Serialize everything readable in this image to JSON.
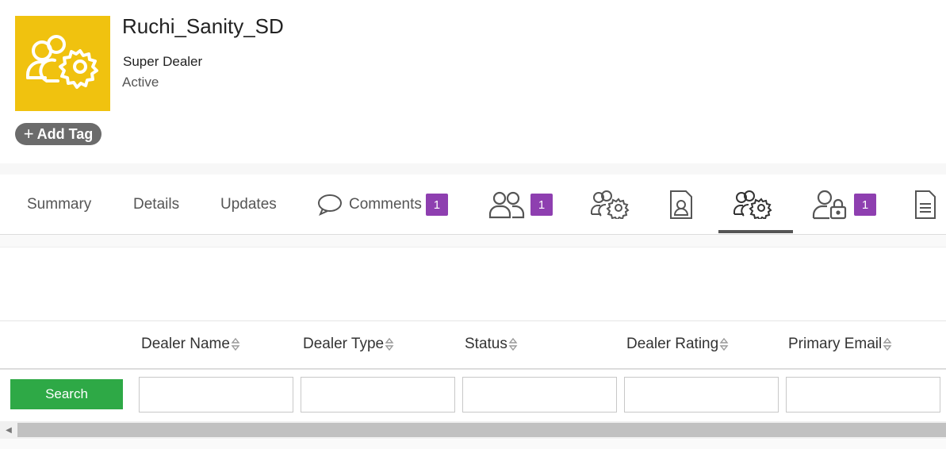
{
  "entity": {
    "title": "Ruchi_Sanity_SD",
    "type": "Super Dealer",
    "status": "Active",
    "avatar_icon": "users-gear-icon",
    "avatar_color": "#f0c20f"
  },
  "add_tag": {
    "label": "Add Tag",
    "plus": "+"
  },
  "tabs": [
    {
      "label": "Summary"
    },
    {
      "label": "Details"
    },
    {
      "label": "Updates"
    },
    {
      "label": "Comments",
      "icon": "comment-icon",
      "badge": "1"
    },
    {
      "icon": "users-icon",
      "badge": "1"
    },
    {
      "icon": "users-gear-icon"
    },
    {
      "icon": "id-badge-icon"
    },
    {
      "icon": "users-gear-icon",
      "active": true
    },
    {
      "icon": "user-lock-icon",
      "badge": "1"
    },
    {
      "icon": "document-icon"
    }
  ],
  "table": {
    "columns": [
      "Dealer Name",
      "Dealer Type",
      "Status",
      "Dealer Rating",
      "Primary Email"
    ]
  },
  "search_button": {
    "label": "Search",
    "color": "#2ea946"
  },
  "colors": {
    "badge": "#8e3fb0",
    "accent": "#f0c20f"
  }
}
